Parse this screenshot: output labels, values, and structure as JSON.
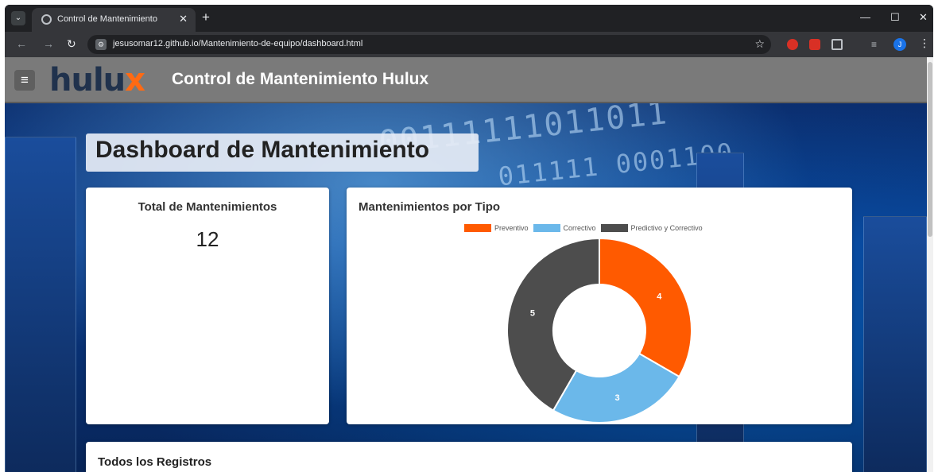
{
  "browser": {
    "tab_title": "Control de Mantenimiento",
    "url": "jesusomar12.github.io/Mantenimiento-de-equipo/dashboard.html",
    "profile_initial": "J"
  },
  "header": {
    "logo_main": "hulu",
    "logo_accent": "x",
    "title": "Control de Mantenimiento Hulux"
  },
  "dashboard": {
    "title": "Dashboard de Mantenimiento",
    "total_card": {
      "title": "Total de Mantenimientos",
      "value": "12"
    },
    "chart_card": {
      "title": "Mantenimientos por Tipo"
    },
    "records_card": {
      "title": "Todos los Registros"
    }
  },
  "chart_data": {
    "type": "pie",
    "variant": "doughnut",
    "categories": [
      "Preventivo",
      "Correctivo",
      "Predictivo y Correctivo"
    ],
    "values": [
      4,
      3,
      5
    ],
    "colors": [
      "#ff5a00",
      "#6bb8ea",
      "#4d4d4d"
    ],
    "legend_position": "top",
    "data_labels": true
  },
  "colors": {
    "header_bg": "#7a7a7a",
    "logo_dark": "#20324d",
    "logo_accent": "#ff6a13"
  }
}
